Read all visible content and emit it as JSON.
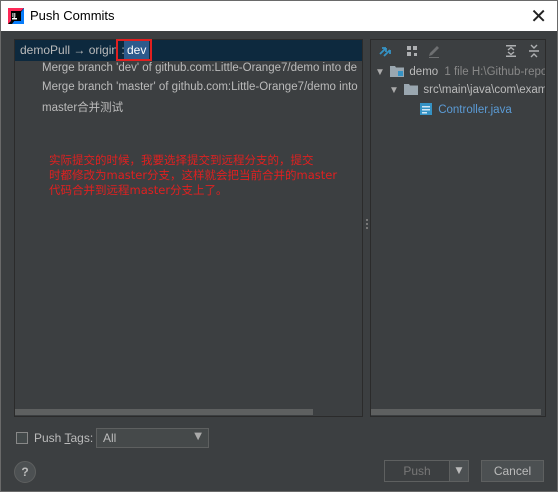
{
  "window": {
    "title": "Push Commits",
    "close_glyph": "✕"
  },
  "branch": {
    "source": "demoPull",
    "arrow": "→",
    "remote": "origin :",
    "target": "dev"
  },
  "commits": [
    "Merge branch 'dev' of github.com:Little-Orange7/demo into de",
    "Merge branch 'master' of github.com:Little-Orange7/demo into",
    "master合并测试"
  ],
  "annotation": [
    "实际提交的时候，我要选择提交到远程分支的，提交",
    "时都修改为master分支，这样就会把当前合并的master",
    "代码合并到远程master分支上了。"
  ],
  "tree": {
    "root": {
      "name": "demo",
      "info": "1 file  H:\\Github-repo"
    },
    "folder": "src\\main\\java\\com\\exam",
    "file": "Controller.java"
  },
  "footer": {
    "push_tags_label": "Push Tags:",
    "push_tags_mnemonic": "T",
    "tags_value": "All",
    "help_label": "?",
    "push_label": "Push",
    "cancel_label": "Cancel"
  },
  "colors": {
    "background": "#3c3f41",
    "selection": "#0d293e",
    "branch_highlight": "#2d5a8c",
    "annotation_red": "#e02020",
    "file_link": "#5b9bd5"
  },
  "icons": [
    "app-icon",
    "swap-icon",
    "group-icon",
    "edit-icon",
    "expand-all-icon",
    "collapse-all-icon",
    "module-folder-icon",
    "folder-icon",
    "java-class-icon"
  ]
}
